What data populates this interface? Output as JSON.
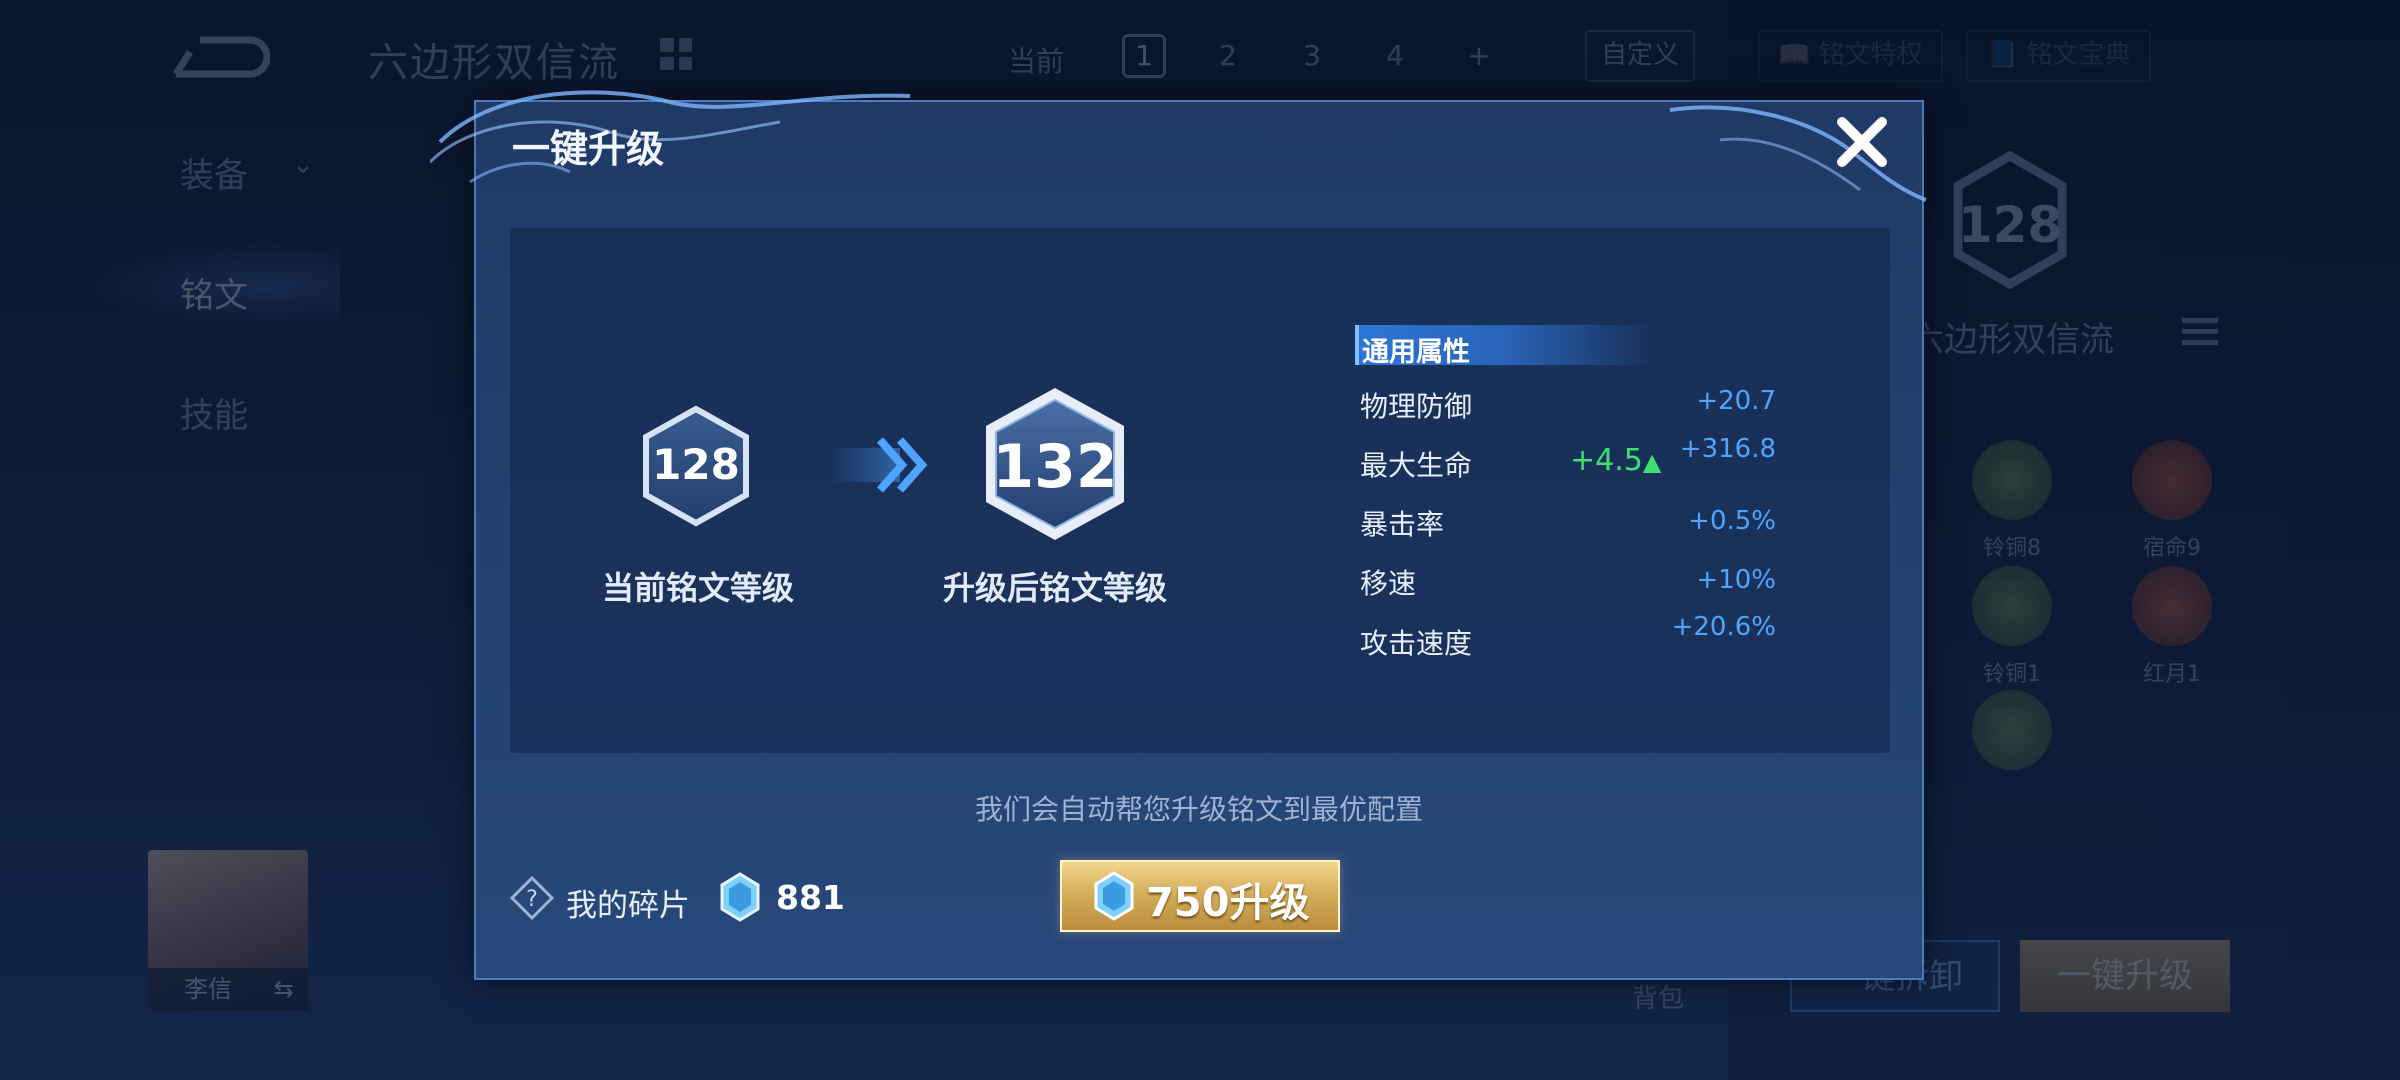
{
  "background": {
    "page_title": "六边形双信流",
    "current_label": "当前",
    "page_tabs": [
      "1",
      "2",
      "3",
      "4",
      "+"
    ],
    "active_tab": "1",
    "custom_button": "自定义",
    "rune_privilege_button": "铭文特权",
    "rune_handbook_button": "铭文宝典",
    "left_nav": [
      "装备",
      "铭文",
      "技能"
    ],
    "active_nav": "铭文",
    "hero_name": "李信",
    "right_level": "128",
    "right_title": "六边形双信流",
    "runes": [
      {
        "label": "铃铜8"
      },
      {
        "label": "宿命9"
      },
      {
        "label": "铃铜1"
      },
      {
        "label": "红月1"
      }
    ],
    "bag_label": "背包",
    "remove_all_button": "一键拆卸",
    "upgrade_all_button": "一键升级"
  },
  "modal": {
    "title": "一键升级",
    "current_level": "128",
    "current_label": "当前铭文等级",
    "new_level": "132",
    "new_label": "升级后铭文等级",
    "attributes_header": "通用属性",
    "attributes": [
      {
        "name": "物理防御",
        "value": "+20.7",
        "bonus": ""
      },
      {
        "name": "最大生命",
        "value": "+316.8",
        "bonus": "+4.5"
      },
      {
        "name": "暴击率",
        "value": "+0.5%",
        "bonus": ""
      },
      {
        "name": "移速",
        "value": "+10%",
        "bonus": ""
      },
      {
        "name": "攻击速度",
        "value": "+20.6%",
        "bonus": ""
      }
    ],
    "info_text": "我们会自动帮您升级铭文到最优配置",
    "shards_label": "我的碎片",
    "shards_count": "881",
    "upgrade_cost": "750",
    "upgrade_button": "750升级"
  },
  "colors": {
    "accent_blue": "#4ea4ff",
    "bonus_green": "#3fe070",
    "gold_button": "#d6b05c"
  }
}
